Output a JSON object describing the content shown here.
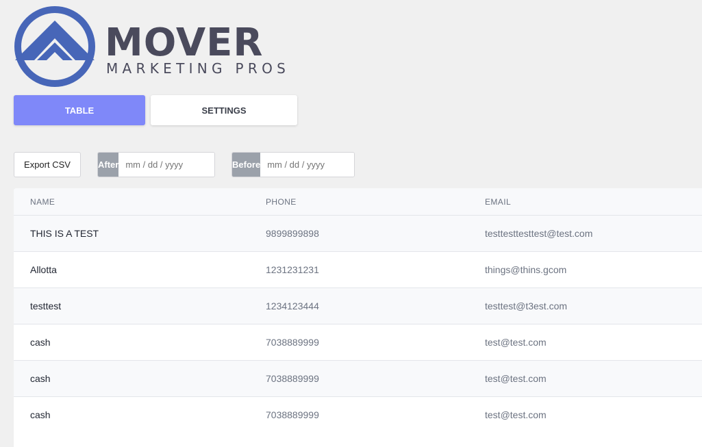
{
  "brand": {
    "name": "MOVER",
    "tagline": "MARKETING PROS",
    "colors": {
      "blue": "#4766b8",
      "gray": "#4a4a5c"
    }
  },
  "tabs": [
    {
      "label": "TABLE",
      "active": true
    },
    {
      "label": "SETTINGS",
      "active": false
    }
  ],
  "toolbar": {
    "export_label": "Export CSV",
    "after_label": "After",
    "after_placeholder": "mm / dd / yyyy",
    "before_label": "Before",
    "before_placeholder": "mm / dd / yyyy"
  },
  "table": {
    "headers": {
      "name": "NAME",
      "phone": "PHONE",
      "email": "EMAIL"
    },
    "rows": [
      {
        "name": "THIS IS A TEST",
        "phone": "9899899898",
        "email": "testtesttesttest@test.com"
      },
      {
        "name": "Allotta",
        "phone": "1231231231",
        "email": "things@thins.gcom"
      },
      {
        "name": "testtest",
        "phone": "1234123444",
        "email": "testtest@t3est.com"
      },
      {
        "name": "cash",
        "phone": "7038889999",
        "email": "test@test.com"
      },
      {
        "name": "cash",
        "phone": "7038889999",
        "email": "test@test.com"
      },
      {
        "name": "cash",
        "phone": "7038889999",
        "email": "test@test.com"
      }
    ]
  },
  "colors": {
    "active_tab": "#7f88f9",
    "date_label_bg": "#9ba1aa",
    "page_bg": "#f0f0f0"
  }
}
